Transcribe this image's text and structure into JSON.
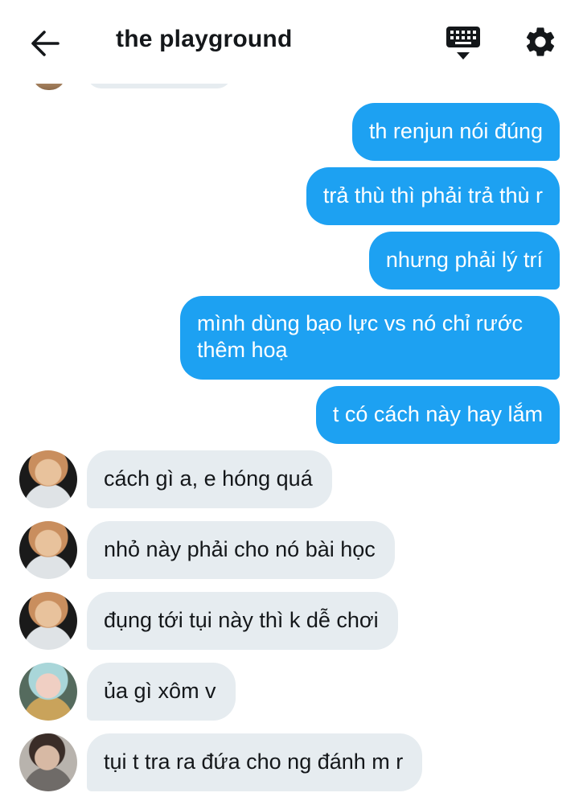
{
  "header": {
    "title": "the playground",
    "back_icon": "arrow-left-icon",
    "keyboard_icon": "keyboard-icon",
    "settings_icon": "gear-icon"
  },
  "colors": {
    "sent_bubble": "#1da1f2",
    "received_bubble": "#e6ecf0",
    "text_dark": "#14171a"
  },
  "messages": {
    "sent": [
      "th renjun nói đúng",
      "trả thù thì phải trả thù r",
      "nhưng phải lý trí",
      "mình dùng bạo lực vs nó chỉ rước thêm hoạ",
      "t có cách này hay lắm"
    ],
    "received": [
      "cách gì a, e hóng quá",
      "nhỏ này phải cho nó bài học",
      "đụng tới tụi này thì k dễ chơi",
      "ủa gì xôm v",
      "tụi t tra ra đứa cho ng đánh m r"
    ]
  }
}
